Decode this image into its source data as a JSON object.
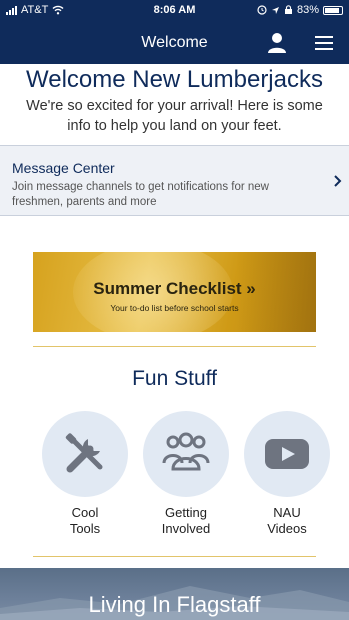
{
  "status_bar": {
    "carrier": "AT&T",
    "time": "8:06 AM",
    "battery": "83%"
  },
  "header": {
    "title": "Welcome"
  },
  "welcome": {
    "title": "Welcome New Lumberjacks",
    "subtitle": "We're so excited for your arrival! Here is some info to help you land on your feet."
  },
  "message_center": {
    "title": "Message Center",
    "description": "Join message channels to get notifications for new freshmen, parents and more"
  },
  "banner": {
    "title": "Summer Checklist »",
    "subtitle": "Your to-do list before school starts"
  },
  "fun_stuff": {
    "title": "Fun Stuff",
    "tiles": [
      {
        "line1": "Cool",
        "line2": "Tools",
        "icon": "tools-icon"
      },
      {
        "line1": "Getting",
        "line2": "Involved",
        "icon": "group-icon"
      },
      {
        "line1": "NAU",
        "line2": "Videos",
        "icon": "video-play-icon"
      }
    ]
  },
  "living": {
    "title": "Living In Flagstaff"
  },
  "colors": {
    "brand_navy": "#0f2b5b",
    "tile_bg": "#e1e9f3",
    "gold": "#d6a21e"
  }
}
